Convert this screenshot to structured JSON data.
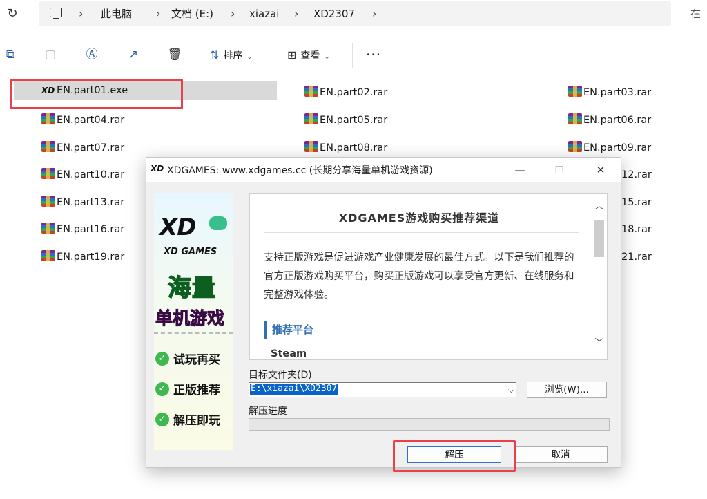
{
  "address_bar": {
    "crumbs": [
      "此电脑",
      "文档 (E:)",
      "xiazai",
      "XD2307"
    ],
    "search_peek": "在"
  },
  "toolbar": {
    "sort_label": "排序",
    "view_label": "查看",
    "more_label": "···"
  },
  "files": [
    {
      "name": "EN.part01.exe",
      "type": "exe",
      "icon_text": "XD",
      "selected": true
    },
    {
      "name": "EN.part02.rar",
      "type": "rar"
    },
    {
      "name": "EN.part03.rar",
      "type": "rar"
    },
    {
      "name": "EN.part04.rar",
      "type": "rar"
    },
    {
      "name": "EN.part05.rar",
      "type": "rar"
    },
    {
      "name": "EN.part06.rar",
      "type": "rar"
    },
    {
      "name": "EN.part07.rar",
      "type": "rar"
    },
    {
      "name": "EN.part08.rar",
      "type": "rar"
    },
    {
      "name": "EN.part09.rar",
      "type": "rar"
    },
    {
      "name": "EN.part10.rar",
      "type": "rar"
    },
    {
      "name": "EN.part13.rar",
      "type": "rar"
    },
    {
      "name": "EN.part16.rar",
      "type": "rar"
    },
    {
      "name": "EN.part19.rar",
      "type": "rar"
    },
    {
      "name": "12.rar",
      "type": "partial"
    },
    {
      "name": "15.rar",
      "type": "partial"
    },
    {
      "name": "18.rar",
      "type": "partial"
    },
    {
      "name": "21.rar",
      "type": "partial"
    }
  ],
  "dialog": {
    "logo": "XD",
    "title": "XDGAMES: www.xdgames.cc (长期分享海量单机游戏资源)",
    "controls": {
      "minimize": "—",
      "maximize": "☐",
      "close": "✕"
    },
    "banner": {
      "logo": "XD",
      "subtitle": "XD GAMES",
      "headline": "海量",
      "tagline": [
        "单",
        "机",
        "游",
        "戏"
      ],
      "features": [
        "试玩再买",
        "正版推荐",
        "解压即玩"
      ]
    },
    "info": {
      "title": "XDGAMES游戏购买推荐渠道",
      "paragraph": "支持正版游戏是促进游戏产业健康发展的最佳方式。以下是我们推荐的官方正版游戏购买平台，购买正版游戏可以享受官方更新、在线服务和完整游戏体验。",
      "section_heading": "推荐平台",
      "first_item": "Steam"
    },
    "dest_label": "目标文件夹(D)",
    "dest_path": "E:\\xiazai\\XD2307",
    "browse_label": "浏览(W)...",
    "progress_label": "解压进度",
    "progress": 0,
    "extract_label": "解压",
    "cancel_label": "取消"
  },
  "colors": {
    "highlight_red": "#e8414a",
    "selection_blue": "#0a64c8",
    "accent_blue": "#2f6fb3"
  }
}
